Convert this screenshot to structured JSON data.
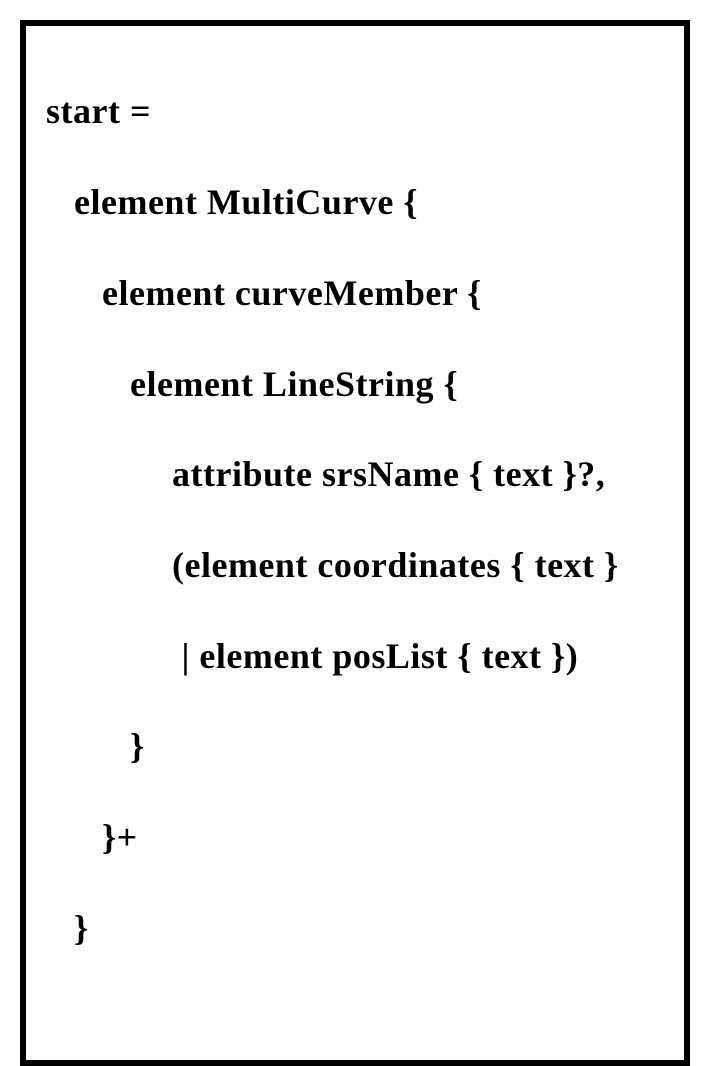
{
  "code": {
    "l1": "start =",
    "l2": "element MultiCurve {",
    "l3": "element curveMember {",
    "l4": "element LineString {",
    "l5": "attribute srsName { text }?,",
    "l6": "(element coordinates { text }",
    "l7": " | element posList { text })",
    "l8": "}",
    "l9": "}+",
    "l10": "}"
  }
}
